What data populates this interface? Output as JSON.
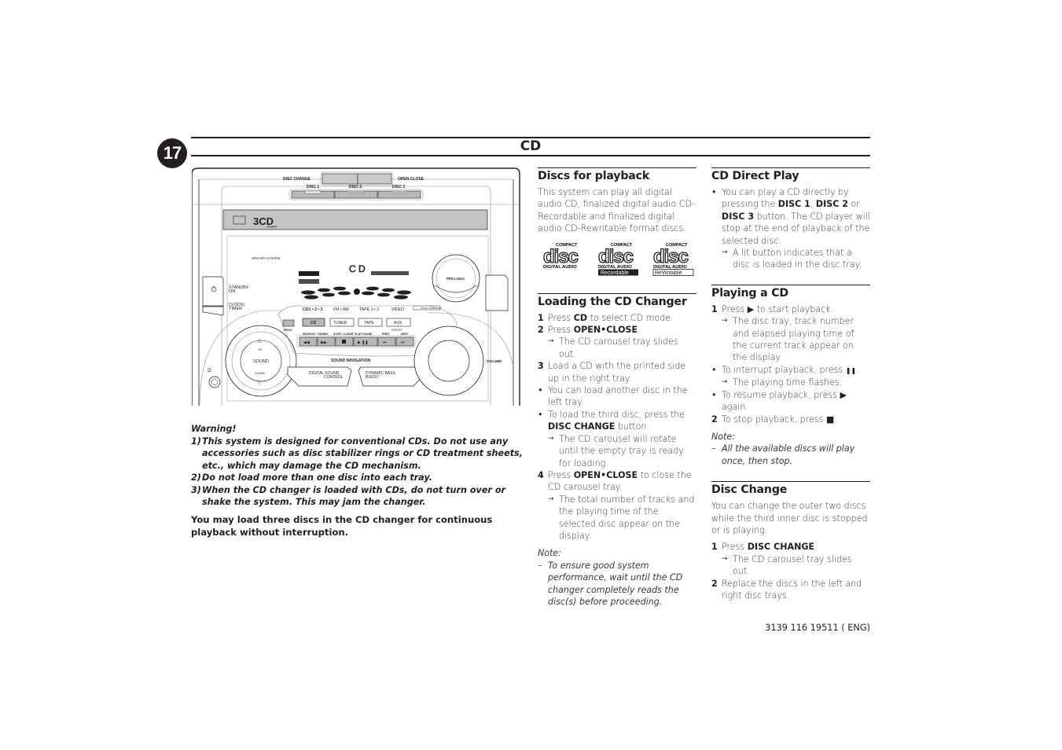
{
  "page": {
    "number": "17",
    "chapter_title": "CD",
    "footer_code": "3139 116 19511 ( ENG)"
  },
  "device": {
    "labels": {
      "disc_change": "DISC CHANGE",
      "open_close": "OPEN-CLOSE",
      "disc1": "DISC 1",
      "disc2": "DISC 2",
      "disc3": "DISC 3",
      "brand_3cd": "3CD",
      "brand_changer": "CHANGER",
      "mini_hifi": "MINI HIFI SYSTEM",
      "standby": "STANDBY",
      "on": "ON",
      "clock": "CLOCK/",
      "timer": "TIMER",
      "display_cd": "C D",
      "pro_logic": "PRO LOGIC",
      "src_cd123": "CD1 • 2 • 3",
      "src_fmam": "FM • AM",
      "src_tape12": "TAPE 1 • 2",
      "src_video": "VIDEO",
      "btn_cd": "CD",
      "btn_tuner": "TUNER",
      "btn_tape": "TAPE",
      "btn_aux": "AUX",
      "prog": "PROG",
      "preset": "PRESET",
      "search_tuning": "SEARCH • TUNING",
      "stop_clear": "STOP • CLEAR",
      "play_pause": "PLAY  PAUSE",
      "prev": "PREV",
      "next": "NEXT",
      "sound_navigation": "SOUND NAVIGATION",
      "sound": "SOUND",
      "up": "UP",
      "down": "DOWN",
      "dsc1": "DIGITAL SOUND",
      "dsc2": "CONTROL",
      "dbb1": "DYNAMIC BASS",
      "dbb2": "BOOST",
      "volume": "VOLUME",
      "dolby": "DOLBY SURROUND"
    }
  },
  "warning": {
    "title": "Warning!",
    "items": [
      {
        "num": "1)",
        "text": "This system is designed for conventional CDs. Do not use any accessories such as disc stabilizer rings or CD treatment sheets, etc., which may damage the CD mechanism."
      },
      {
        "num": "2)",
        "text": "Do not load more than one disc into each tray."
      },
      {
        "num": "3)",
        "text": "When the CD changer is loaded with CDs, do not turn over or shake the system. This may jam the changer."
      }
    ],
    "load_note": "You may load three discs in the CD changer for continuous playback without interruption."
  },
  "discs_for_playback": {
    "title": "Discs for playback",
    "body": "This system can play all digital audio CD, finalized digital audio CD-Recordable and finalized digital audio CD-Rewritable format discs.",
    "logos": [
      {
        "top": "COMPACT",
        "main": "disc",
        "bottom": "DIGITAL AUDIO",
        "badge": ""
      },
      {
        "top": "COMPACT",
        "main": "disc",
        "bottom": "DIGITAL AUDIO",
        "badge": "Recordable"
      },
      {
        "top": "COMPACT",
        "main": "disc",
        "bottom": "DIGITAL AUDIO",
        "badge": "ReWritable"
      }
    ]
  },
  "loading": {
    "title": "Loading the CD Changer",
    "s1_num": "1",
    "s1_pre": "Press ",
    "s1_bold": "CD",
    "s1_post": " to select CD mode.",
    "s2_num": "2",
    "s2_pre": "Press ",
    "s2_bold": "OPEN•CLOSE",
    "s2_post": ".",
    "s2_arrow": "The CD carousel tray slides out.",
    "s3_num": "3",
    "s3_text": "Load a CD with the printed side up in the right tray.",
    "b1": "You can load another disc in the left tray.",
    "b2_pre": "To load the third disc, press the ",
    "b2_bold": "DISC CHANGE",
    "b2_post": " button.",
    "b2_arrow": "The CD carousel will rotate until the empty tray is ready for loading.",
    "s4_num": "4",
    "s4_pre": "Press ",
    "s4_bold": "OPEN•CLOSE",
    "s4_post": " to close the CD carousel tray.",
    "s4_arrow": "The total number of tracks and the playing time of the selected disc appear on the display.",
    "note_title": "Note:",
    "note_text": "To ensure good system performance, wait until the CD changer completely reads the disc(s) before proceeding."
  },
  "direct_play": {
    "title": "CD Direct Play",
    "b1_pre": "You can play a CD directly by pressing the ",
    "b1_d1": "DISC 1",
    "b1_sep1": ", ",
    "b1_d2": "DISC 2",
    "b1_sep2": " or ",
    "b1_d3": "DISC 3",
    "b1_post": " button. The CD player will stop at the end of playback of the selected disc.",
    "arrow": "A lit button indicates that a disc is loaded in the disc tray."
  },
  "playing": {
    "title": "Playing a CD",
    "s1_num": "1",
    "s1_pre": "Press ",
    "s1_icon": "▶",
    "s1_post": " to start playback.",
    "s1_arrow": "The disc tray, track number and elapsed playing time of the current track appear on the display.",
    "b1_pre": "To interrupt playback, press ",
    "b1_icon": "❚❚",
    "b1_post": ".",
    "b1_arrow": "The playing time flashes.",
    "b2_pre": "To resume playback, press ",
    "b2_icon": "▶",
    "b2_post": " again.",
    "s2_num": "2",
    "s2_pre": "To stop playback, press ",
    "s2_icon": "■",
    "s2_post": ".",
    "note_title": "Note:",
    "note_text": "All the available discs will play once, then stop."
  },
  "disc_change": {
    "title": "Disc Change",
    "body": "You can change the outer two discs while the third inner disc is stopped or is playing.",
    "s1_num": "1",
    "s1_pre": "Press ",
    "s1_bold": "DISC CHANGE",
    "s1_post": ".",
    "s1_arrow": "The CD carousel tray slides out.",
    "s2_num": "2",
    "s2_text": "Replace the discs in the left and right disc trays."
  },
  "symbols": {
    "arrow": "→",
    "bullet": "•",
    "dash": "–"
  }
}
